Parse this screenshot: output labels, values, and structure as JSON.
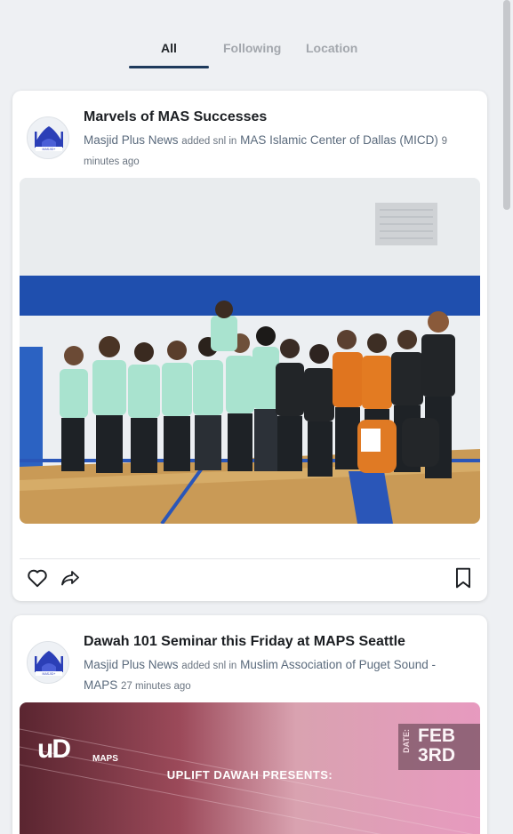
{
  "tabs": [
    {
      "label": "All",
      "active": true
    },
    {
      "label": "Following",
      "active": false
    },
    {
      "label": "Location",
      "active": false
    }
  ],
  "posts": [
    {
      "title": "Marvels of MAS Successes",
      "author": "Masjid Plus News",
      "added_text": "added snl in",
      "location": "MAS Islamic Center of Dallas (MICD)",
      "time": "9 minutes ago",
      "image_icon": "team-group-photo"
    },
    {
      "title": "Dawah 101 Seminar this Friday at MAPS Seattle",
      "author": "Masjid Plus News",
      "added_text": "added snl in",
      "location": "Muslim Association of Puget Sound - MAPS",
      "time": "27 minutes ago",
      "image_icon": "seminar-flyer",
      "flyer": {
        "presents": "UPLIFT DAWAH PRESENTS:",
        "date_label": "DATE:",
        "date_month": "FEB",
        "date_day": "3RD",
        "logo1": "uD",
        "logo2": "MAPS"
      }
    }
  ],
  "icons": {
    "like": "heart-icon",
    "share": "share-icon",
    "save": "bookmark-icon"
  },
  "colors": {
    "tab_active": "#202428",
    "tab_inactive": "#a3a7ad",
    "underline": "#1e3a5c",
    "meta_text": "#5a6a7c"
  }
}
